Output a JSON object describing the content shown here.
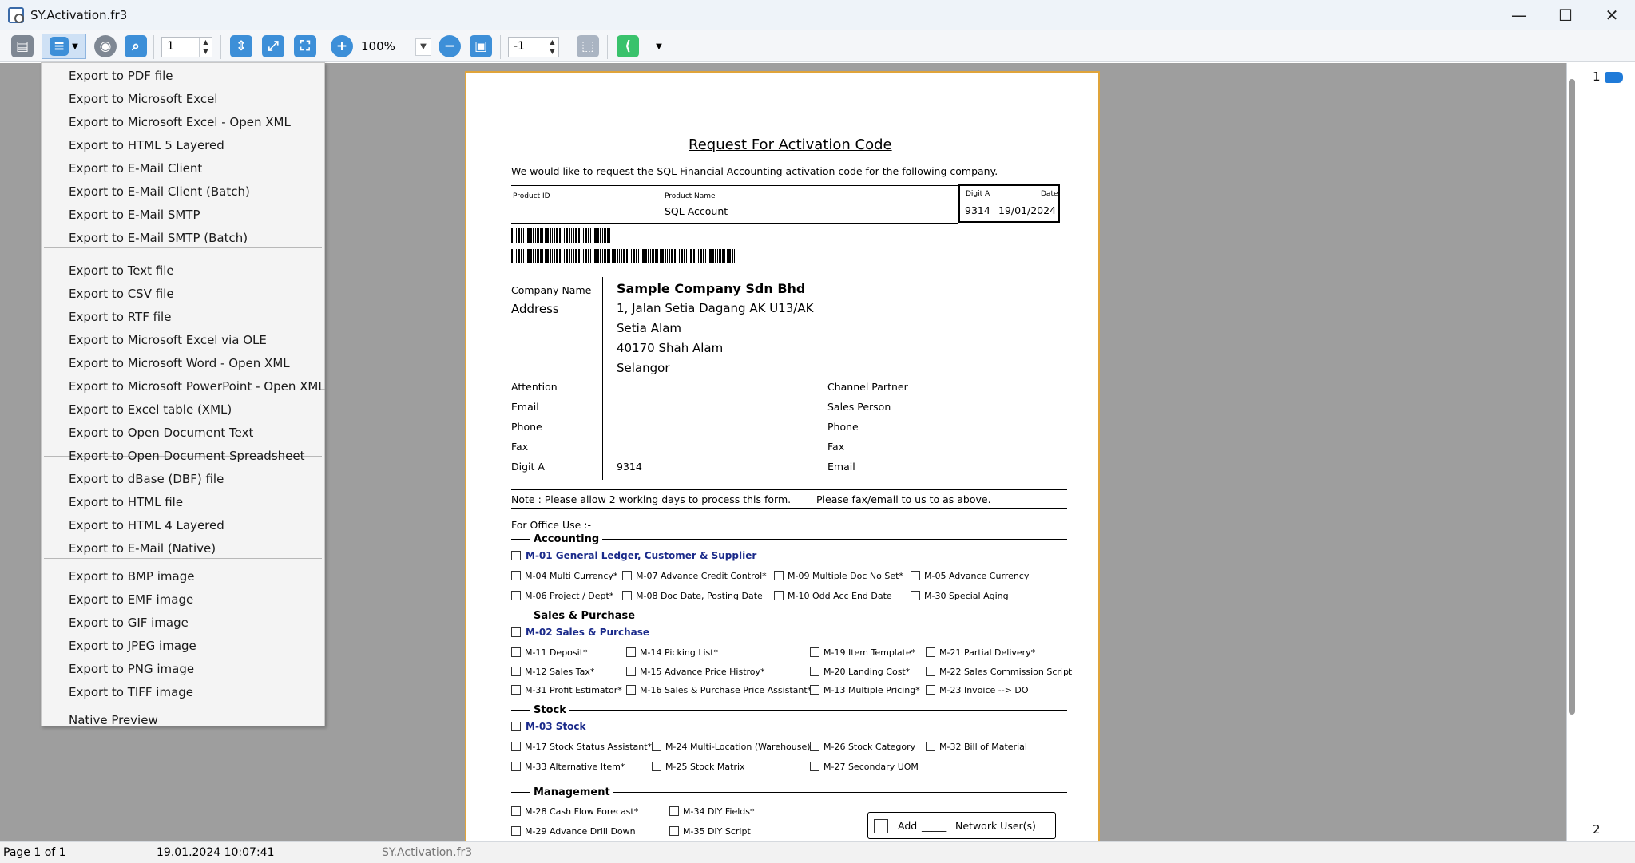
{
  "window": {
    "title": "SY.Activation.fr3",
    "minimize": "—",
    "maximize": "☐",
    "close": "✕"
  },
  "toolbar": {
    "page_value": "1",
    "zoom_value": "100%",
    "page_offset_value": "-1"
  },
  "export_menu": {
    "items": [
      "Export to PDF file",
      "Export to Microsoft Excel",
      "Export to Microsoft Excel - Open XML",
      "Export to HTML 5 Layered",
      "Export to E-Mail Client",
      "Export to E-Mail Client (Batch)",
      "Export to E-Mail SMTP",
      "Export to E-Mail SMTP (Batch)",
      "Export to Text file",
      "Export to CSV file",
      "Export to RTF file",
      "Export to Microsoft Excel via OLE",
      "Export to Microsoft Word - Open XML",
      "Export to Microsoft PowerPoint - Open XML",
      "Export to Excel table (XML)",
      "Export to Open Document Text",
      "Export to Open Document Spreadsheet",
      "Export to dBase (DBF) file",
      "Export to HTML file",
      "Export to HTML 4 Layered",
      "Export to E-Mail (Native)",
      "Export to BMP image",
      "Export to EMF image",
      "Export to GIF image",
      "Export to JPEG image",
      "Export to PNG image",
      "Export to TIFF image",
      "Native Preview"
    ]
  },
  "report": {
    "title": "Request For Activation Code",
    "intro": "We would like to request the SQL Financial Accounting activation code for the following company.",
    "product_id_label": "Product ID",
    "product_name_label": "Product Name",
    "product_name": "SQL Account",
    "digit_a_label": "Digit A",
    "date_label": "Date",
    "digit_a": "9314",
    "date": "19/01/2024",
    "company_name_label": "Company Name",
    "company_name": "Sample Company Sdn Bhd",
    "address_label": "Address",
    "address": [
      "1, Jalan Setia Dagang AK U13/AK",
      "Setia Alam",
      "40170 Shah Alam",
      "Selangor"
    ],
    "left_labels": [
      "Attention",
      "Email",
      "Phone",
      "Fax",
      "Digit A"
    ],
    "digit_a_value": "9314",
    "right_labels": [
      "Channel Partner",
      "Sales Person",
      "Phone",
      "Fax",
      "Email"
    ],
    "note": "Note :  Please allow 2 working days to process this form.",
    "note_right": "Please fax/email to us to as above.",
    "office_use": "For Office Use :-",
    "accounting": {
      "title": "Accounting",
      "main": "M-01  General Ledger, Customer & Supplier",
      "modules": [
        "M-04  Multi Currency*",
        "M-07  Advance Credit Control*",
        "M-09  Multiple Doc No Set*",
        "M-05  Advance Currency",
        "M-06  Project / Dept*",
        "M-08  Doc Date, Posting Date",
        "M-10  Odd Acc End Date",
        "M-30  Special Aging"
      ]
    },
    "sales": {
      "title": "Sales & Purchase",
      "main": "M-02  Sales & Purchase",
      "modules": [
        "M-11  Deposit*",
        "M-14  Picking List*",
        "M-19  Item Template*",
        "M-21  Partial Delivery*",
        "M-12  Sales Tax*",
        "M-15  Advance Price Histroy*",
        "M-20  Landing Cost*",
        "M-22  Sales Commission Script",
        "M-31  Profit Estimator*",
        "M-16  Sales & Purchase Price Assistant*",
        "M-13  Multiple Pricing*",
        "M-23  Invoice --> DO"
      ]
    },
    "stock": {
      "title": "Stock",
      "main": "M-03  Stock",
      "modules": [
        "M-17  Stock Status Assistant*",
        "M-24  Multi-Location (Warehouse)",
        "M-26  Stock Category",
        "M-32  Bill of Material",
        "M-33  Alternative Item*",
        "M-25  Stock Matrix",
        "M-27  Secondary UOM"
      ]
    },
    "management": {
      "title": "Management",
      "modules": [
        "M-28  Cash Flow Forecast*",
        "M-34  DIY Fields*",
        "M-29  Advance Drill Down",
        "M-35  DIY Script"
      ]
    },
    "add_users": {
      "add": "Add",
      "blank": "_____",
      "users": "Network User(s)"
    }
  },
  "side_panel": {
    "page_1": "1",
    "page_2": "2"
  },
  "status": {
    "page": "Page 1 of 1",
    "datetime": "19.01.2024 10:07:41",
    "file": "SY.Activation.fr3"
  }
}
